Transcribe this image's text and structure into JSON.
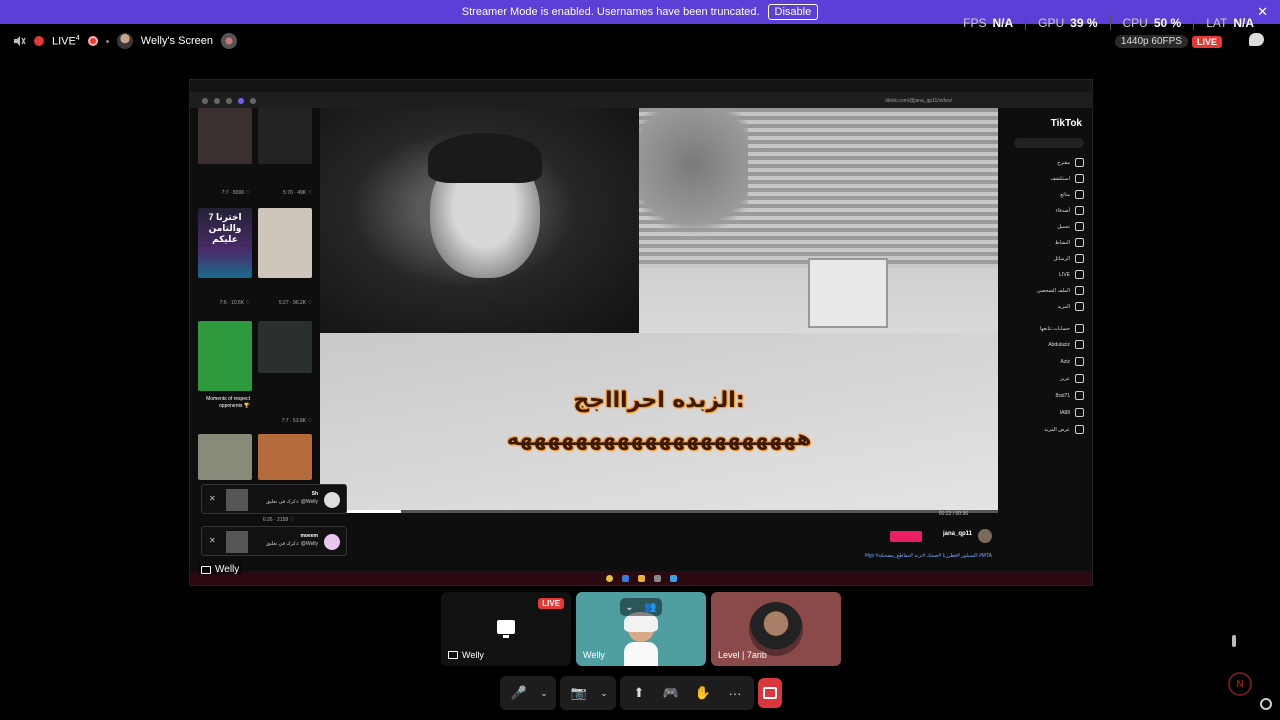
{
  "banner": {
    "text": "Streamer Mode is enabled. Usernames have been truncated.",
    "button": "Disable",
    "close": "✕"
  },
  "header": {
    "live_label": "LIVE",
    "live_sup": "4",
    "stream_title": "Welly's Screen"
  },
  "stats": {
    "fps_label": "FPS",
    "fps_value": "N/A",
    "gpu_label": "GPU",
    "gpu_value": "39 %",
    "cpu_label": "CPU",
    "cpu_value": "50 %",
    "lat_label": "LAT",
    "lat_value": "N/A",
    "quality": "1440p 60FPS",
    "live_badge": "LIVE"
  },
  "tiktok": {
    "brand": "TikTok",
    "url": "tiktok.com/@jana_qp11/video/",
    "subtitle_line1": "الزبده احراااجج:",
    "subtitle_line2": "هههههههههههههههههههههه",
    "video_time": "00:23 / 00:36",
    "progress": 0.12,
    "uploader": "jana_qp11",
    "follow_label": "",
    "hashtags": "#fyp #اكسبلور #فطرزتا #ضحك #ترند #مقاطع_مضحكة #MTA",
    "grid_captions": [
      "7:7 · 8300 ♡",
      "5:70 · 49K ♡",
      "7:6 · 10.5K ♡",
      "5:27 · 96.2K ♡",
      "Moments of respect opponents 🏆",
      "7:7 · 53.8K ♡",
      "6:26 · 2158 ♡"
    ],
    "grid_overlay_text": "اخترنا 7 والتامن عليكم",
    "side_items": [
      "مقترح",
      "استكشف",
      "متابَع",
      "أصدقاء",
      "تحميل",
      "النشاط",
      "الرسائل",
      "LIVE",
      "الملف الشخصي",
      "المزيد"
    ],
    "following_header": "حسابات تتابعها",
    "following": [
      "Abdulaziz",
      "Aziz",
      "عزيز",
      "8ssl71",
      "IA88"
    ],
    "see_more": "عرض المزيد"
  },
  "notifications": [
    {
      "title": "Sh",
      "text": "ذكرك في تعليق: @Welly"
    },
    {
      "title": "moeem",
      "text": "ذكرك في تعليق: @Welly"
    }
  ],
  "screen_tag": "Welly",
  "tiles": [
    {
      "name": "Welly",
      "badge": "LIVE"
    },
    {
      "name": "Welly"
    },
    {
      "name": "Level | 7arib"
    }
  ],
  "controls": {
    "mic": "🎤",
    "video": "📷",
    "share": "⬆",
    "activity": "🎮",
    "soundboard": "✋",
    "more": "···"
  }
}
